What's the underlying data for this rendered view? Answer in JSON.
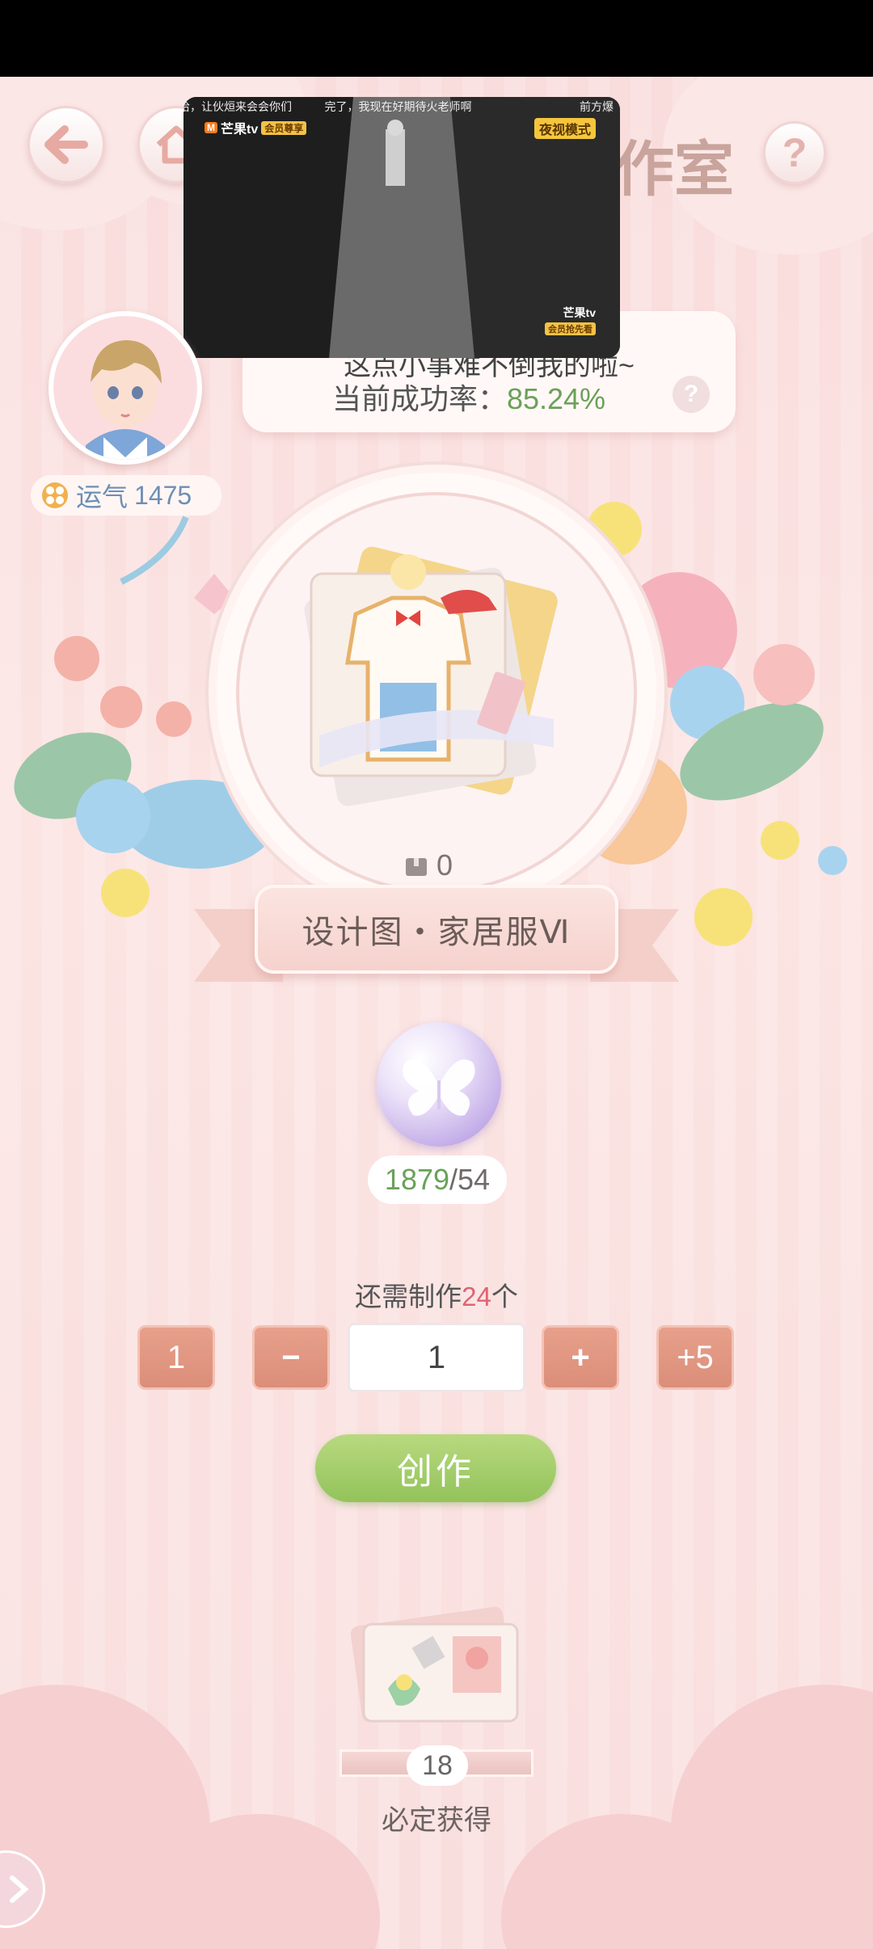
{
  "header": {
    "title": "作室",
    "back_label": "back",
    "home_label": "home",
    "help_label": "?"
  },
  "video": {
    "caption_left": "哈，让伙烜来会会你们",
    "caption_mid": "完了，我现在好期待火老师啊",
    "caption_right": "前方爆",
    "logo_top": "芒果tv",
    "vip_top": "会员尊享",
    "mode": "夜视模式",
    "logo_bottom": "芒果tv",
    "vip_bottom": "会员抢先看"
  },
  "bubble": {
    "line1": "这点小事难不倒我的啦~",
    "rate_label": "当前成功率：",
    "rate_value": "85.24%"
  },
  "luck": {
    "label": "运气",
    "value": "1475"
  },
  "item": {
    "owned_count": "0",
    "name": "设计图・家居服Ⅵ"
  },
  "material": {
    "have": "1879",
    "sep": "/",
    "need": "54"
  },
  "production": {
    "need_prefix": "还需制作",
    "need_count": "24",
    "need_suffix": "个",
    "btn_min": "1",
    "btn_minus": "−",
    "quantity": "1",
    "btn_plus": "+",
    "btn_plus5": "+5",
    "create": "创作"
  },
  "reward": {
    "count": "18",
    "label": "必定获得"
  },
  "colors": {
    "accent_green": "#6aa15a",
    "accent_red": "#e06372",
    "button_salmon": "#db8e79"
  }
}
